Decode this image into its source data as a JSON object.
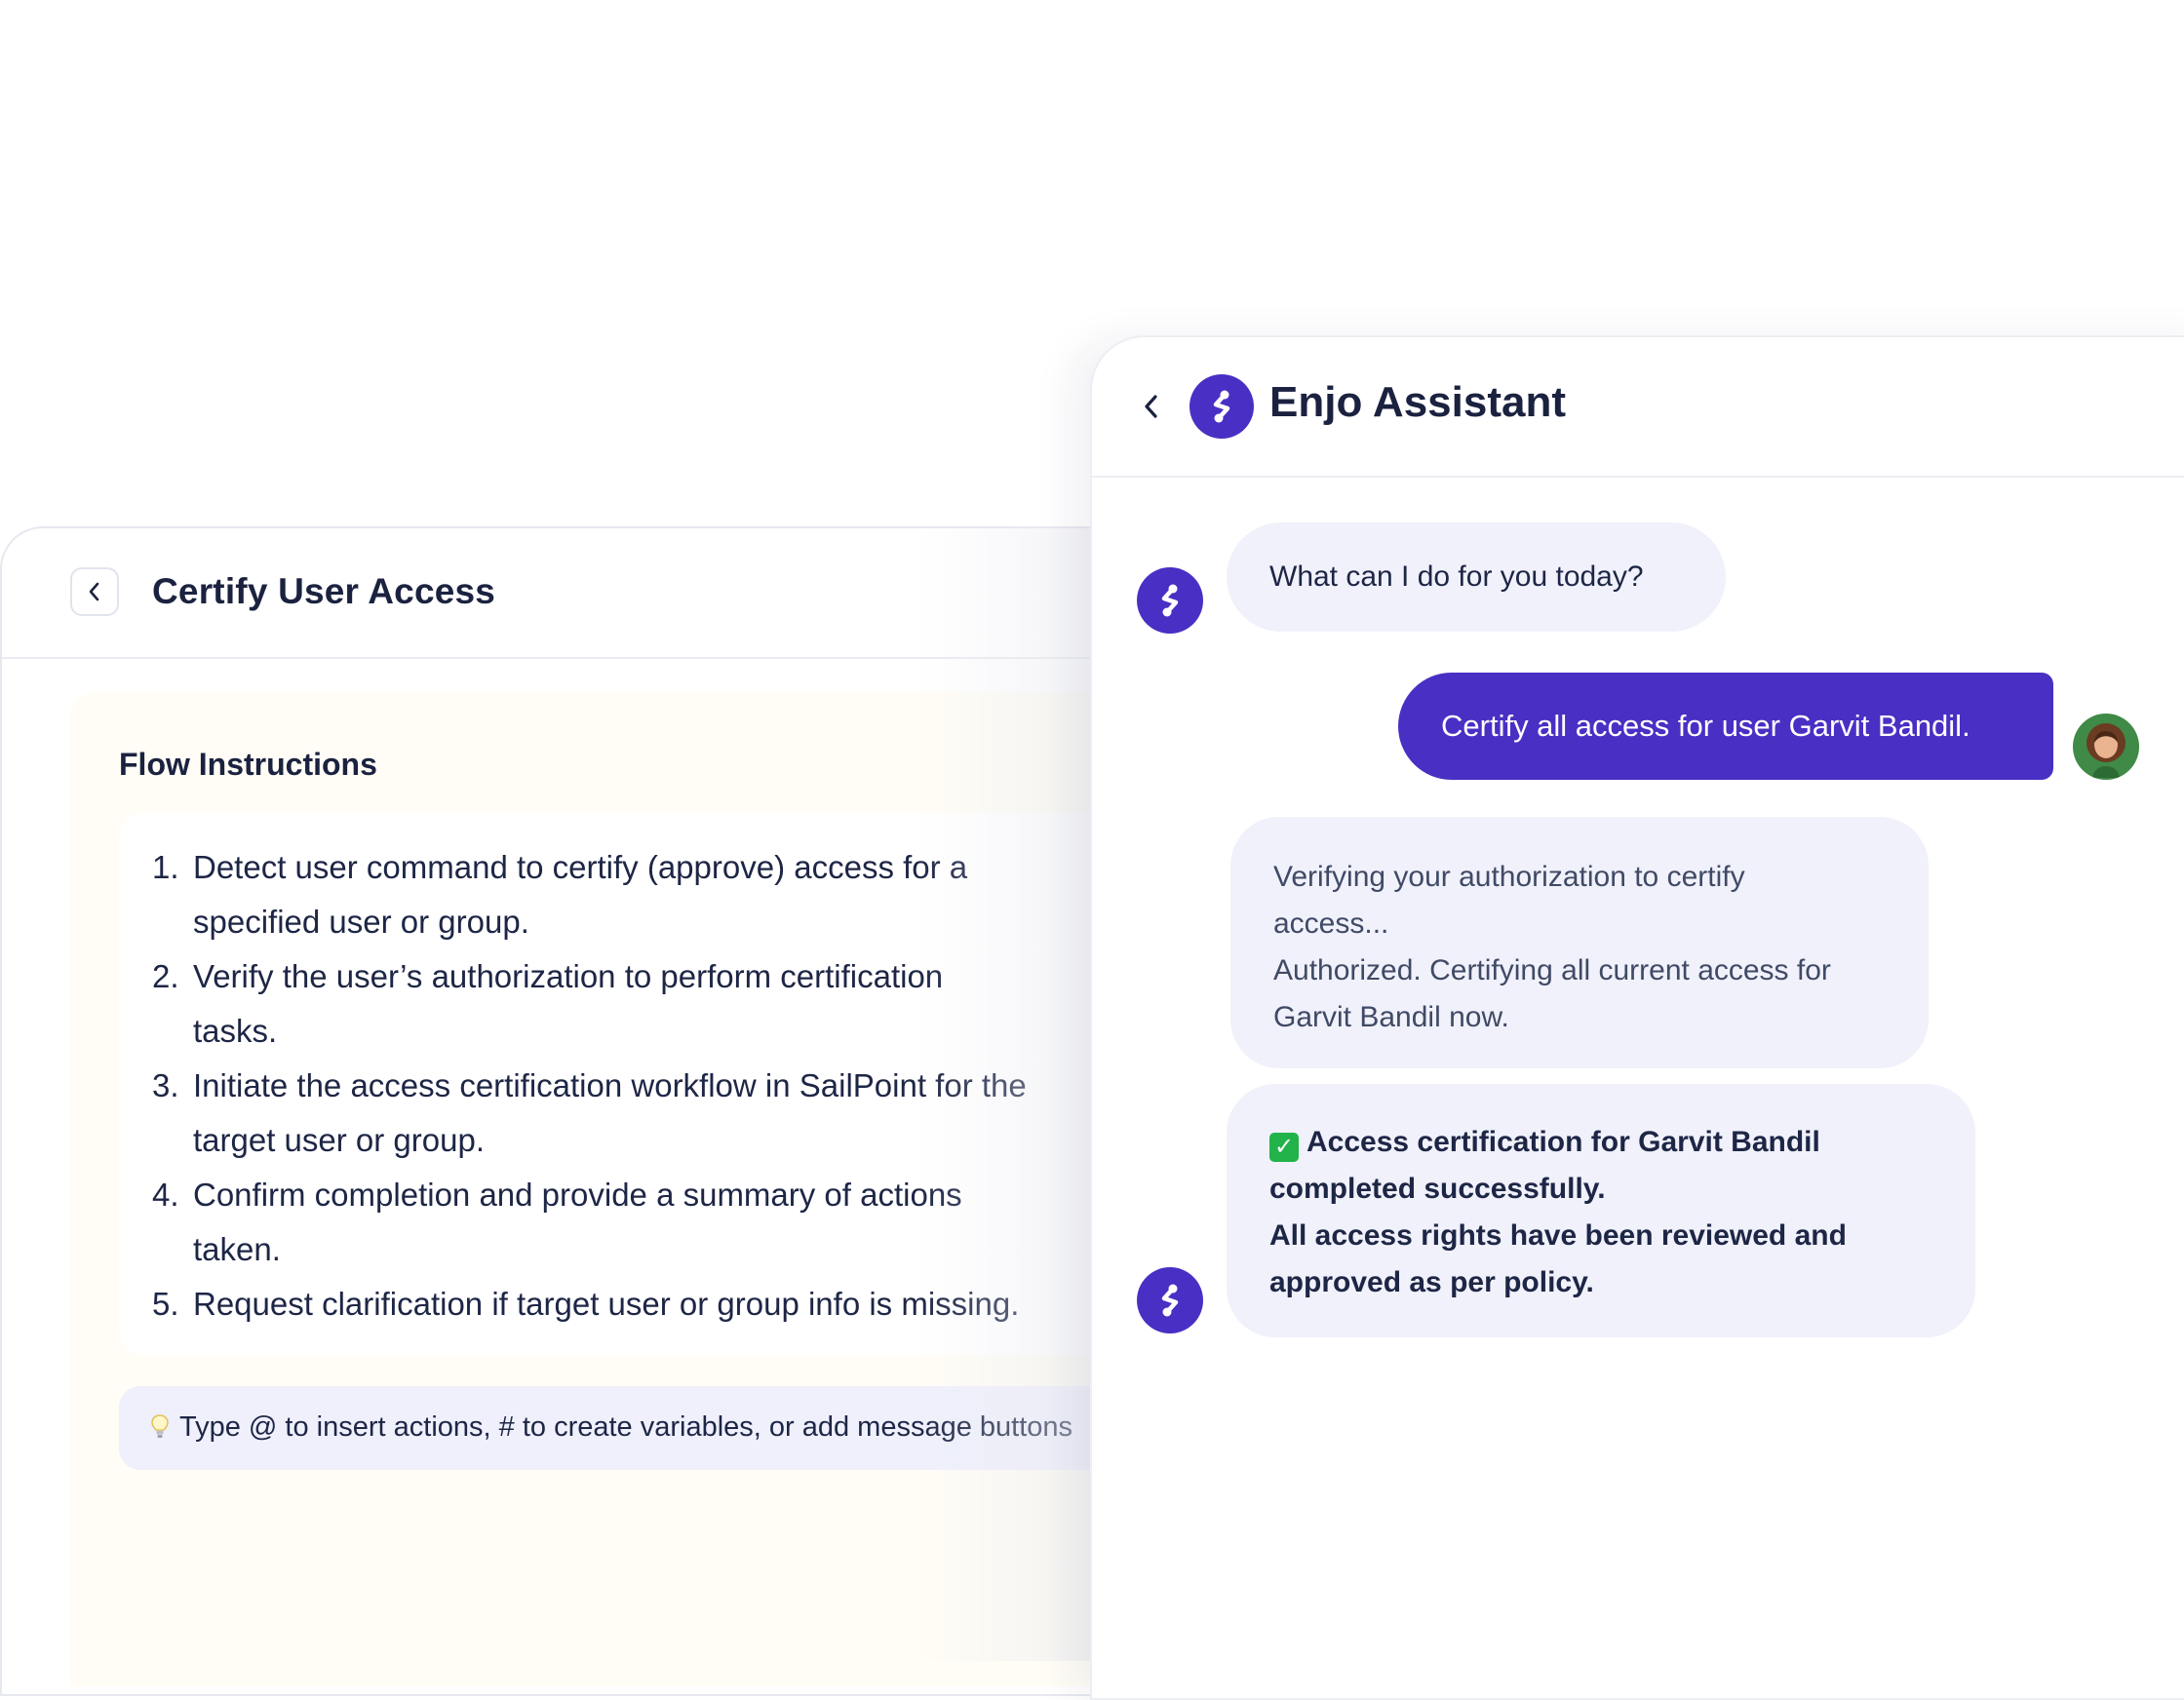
{
  "flow": {
    "title": "Certify User Access",
    "section_heading": "Flow Instructions",
    "steps": [
      {
        "num": "1.",
        "lines": [
          "Detect user command to certify (approve) access for a",
          "specified user or group."
        ]
      },
      {
        "num": "2.",
        "lines": [
          "Verify the user’s authorization to perform certification",
          "tasks."
        ]
      },
      {
        "num": "3.",
        "lines": [
          "Initiate the access certification workflow in SailPoint for the",
          "target user or group."
        ]
      },
      {
        "num": "4.",
        "lines": [
          "Confirm completion and provide a summary of actions",
          "taken."
        ]
      },
      {
        "num": "5.",
        "lines": [
          "Request clarification if target user or group info is missing."
        ]
      }
    ],
    "tip_text": "Type @ to insert actions, # to create variables, or add message buttons"
  },
  "chat": {
    "title": "Enjo Assistant",
    "messages": {
      "greeting": "What can I do for you today?",
      "user_request": "Certify all access for user Garvit Bandil.",
      "verifying_line1": "Verifying your authorization to certify",
      "verifying_line2": "access...",
      "verifying_line3": "Authorized. Certifying all current access for",
      "verifying_line4": "Garvit Bandil now.",
      "result_line1": "Access certification for Garvit Bandil",
      "result_line2": "completed successfully.",
      "result_line3": "All access rights have been reviewed and",
      "result_line4": "approved as per policy."
    }
  },
  "colors": {
    "brand_purple": "#4a2fc4",
    "bubble_bg": "#f0f1fa",
    "instructions_bg": "#fffdf5",
    "check_green": "#21b34a"
  },
  "icons": [
    "chevron-left-icon",
    "enjo-logo-icon",
    "lightbulb-icon",
    "check-mark-icon"
  ]
}
